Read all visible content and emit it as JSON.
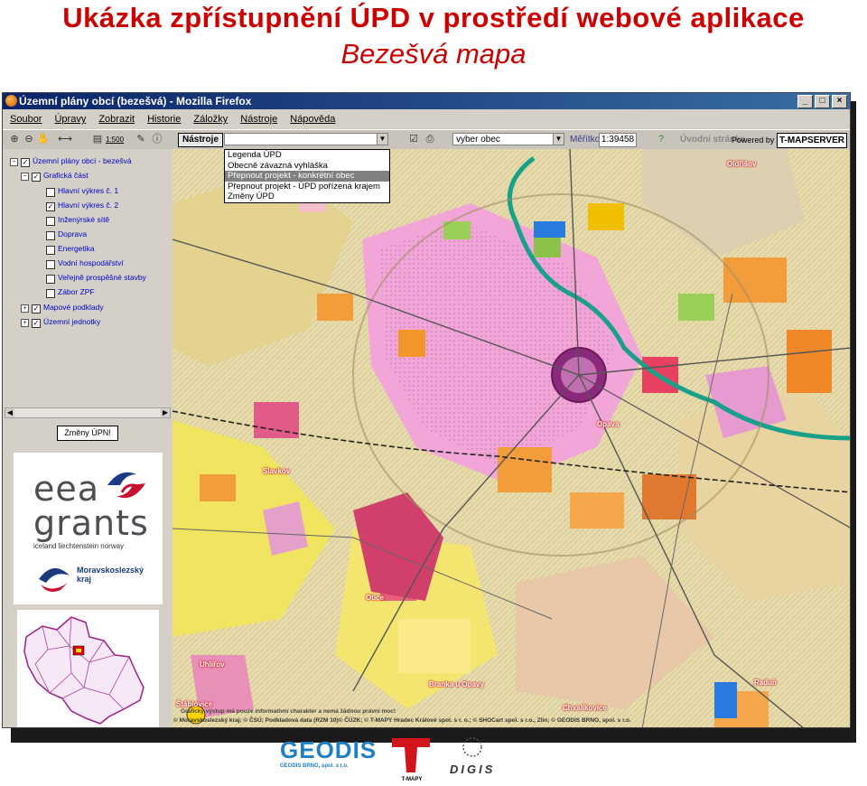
{
  "slide": {
    "title": "Ukázka zpřístupnění ÚPD v prostředí webové aplikace",
    "subtitle": "Bezešvá mapa"
  },
  "window": {
    "title": "Územní plány obcí (bezešvá) - Mozilla Firefox",
    "buttons": [
      "_",
      "□",
      "×"
    ]
  },
  "menu": [
    "Soubor",
    "Úpravy",
    "Zobrazit",
    "Historie",
    "Záložky",
    "Nástroje",
    "Nápověda"
  ],
  "toolbar": {
    "scale_icon_label": "1:500",
    "tools_label": "Nástroje",
    "municipality_select": "vyber obec",
    "scale_label": "Měřítko:",
    "scale_value": "1:39458",
    "initial_page": "Úvodní stránka",
    "powered_by": "Powered by",
    "powered_brand": "T-MAPSERVER"
  },
  "tools_menu": {
    "items": [
      "Legenda ÚPD",
      "Obecně závazná vyhláška",
      "Přepnout projekt - konkrétní obec",
      "Přepnout projekt - ÚPD pořízená krajem",
      "Změny ÚPD"
    ],
    "selected_index": 2
  },
  "layer_tree": {
    "root": "Územní plány obcí - bezešvá",
    "group": "Grafická část",
    "layers": [
      {
        "label": "Hlavní výkres č. 1",
        "checked": false
      },
      {
        "label": "Hlavní výkres č. 2",
        "checked": true
      },
      {
        "label": "Inženýrské sítě",
        "checked": false
      },
      {
        "label": "Doprava",
        "checked": false
      },
      {
        "label": "Energetika",
        "checked": false
      },
      {
        "label": "Vodní hospodářství",
        "checked": false
      },
      {
        "label": "Veřejně prospěšné stavby",
        "checked": false
      },
      {
        "label": "Zábor ZPF",
        "checked": false
      }
    ],
    "other_groups": [
      "Mapové podklady",
      "Územní jednotky"
    ]
  },
  "changes_button": "Změny ÚPN!",
  "eea": {
    "line1": "eea",
    "line2": "grants",
    "countries": "iceland liechtenstein norway",
    "region1": "Moravskoslezský",
    "region2": "kraj"
  },
  "map_labels": {
    "oldrisov": "Oldřišov",
    "opava": "Opava",
    "slavkov": "Slavkov",
    "otice": "Otice",
    "uhlirov": "Uhlířov",
    "stablovice": "Štáblovice",
    "branka": "Branka u Opavy",
    "radun": "Raduň",
    "chvalikovice": "Chvalíkovice"
  },
  "map_footer": {
    "disclaimer": "Grafický výstup má pouze informativní charakter a nemá žádnou právní moc!",
    "copyright": "© Moravskoslezský kraj; © ČSÚ; Podkladová data (RZM 10)© ČÚZK; © T-MAPY Hradec Králové spol. s r. o.; © SHOCart spol. s r.o., Zlín; © GEODIS BRNO, spol. s r.o."
  },
  "bottom_logos": {
    "geodis": "GEODIS",
    "geodis_sub": "GEODIS BRNO, spol. s r.o.",
    "tmapy": "T-MAPY",
    "digis": "DIGIS"
  },
  "colors": {
    "title": "#cc0000",
    "titlebar": "#0a246a",
    "tree_text": "#0000cc"
  }
}
